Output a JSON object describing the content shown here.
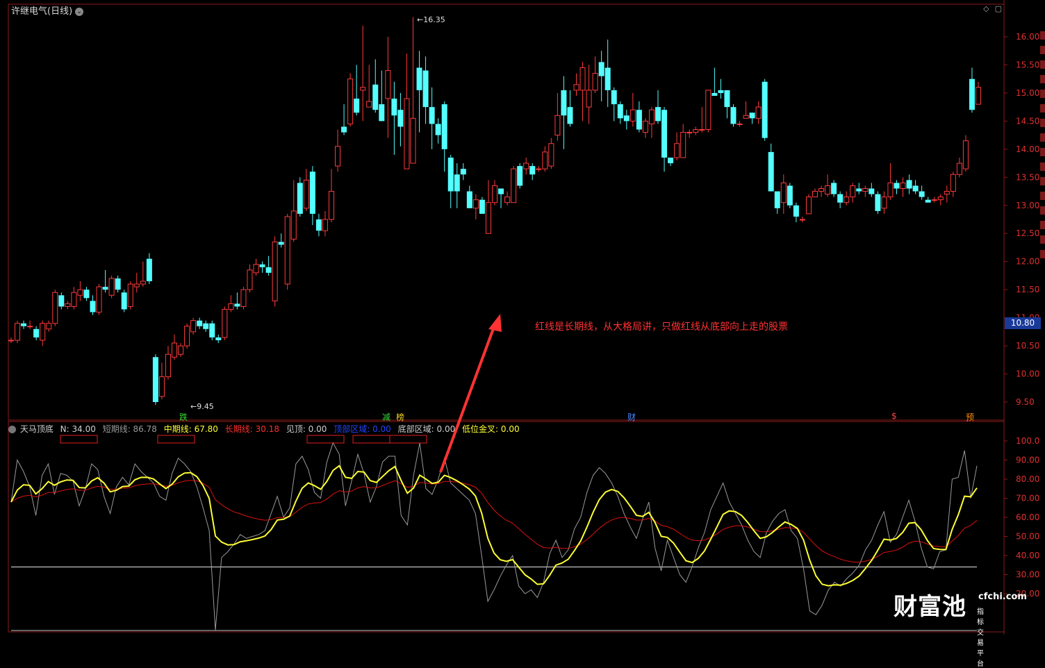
{
  "header": {
    "title": "许继电气(日线)",
    "dropdown_icon": "chevron-down-icon",
    "top_right_icons": [
      "diamond-icon",
      "window-icon"
    ]
  },
  "price_axis": {
    "ticks": [
      "16.00",
      "15.50",
      "15.00",
      "14.50",
      "14.00",
      "13.50",
      "13.00",
      "12.50",
      "12.00",
      "11.50",
      "11.00",
      "10.50",
      "10.00",
      "9.50"
    ],
    "current_price": "10.80"
  },
  "indicator_axis": {
    "ticks": [
      "100.0",
      "90.00",
      "80.00",
      "70.00",
      "60.00",
      "50.00",
      "40.00",
      "30.00",
      "20.00"
    ]
  },
  "price_labels": {
    "high": "16.35",
    "low": "9.45"
  },
  "event_markers": [
    {
      "text": "跌",
      "color": "#33dd33"
    },
    {
      "text": "减",
      "color": "#33dd33"
    },
    {
      "text": "榜",
      "color": "#f0d020"
    },
    {
      "text": "财",
      "color": "#4488ff"
    },
    {
      "text": "$",
      "color": "#ff4040"
    },
    {
      "text": "预",
      "color": "#ff8800"
    }
  ],
  "indicator": {
    "name": "天马顶底",
    "fields": [
      {
        "text": "N: 34.00",
        "color": "#d0d0d0"
      },
      {
        "text": "短期线: 86.78",
        "color": "#9a9a9a"
      },
      {
        "text": "中期线: 67.80",
        "color": "#ffff33"
      },
      {
        "text": "长期线: 30.18",
        "color": "#ff3030"
      },
      {
        "text": "见顶: 0.00",
        "color": "#d0d0d0"
      },
      {
        "text": "顶部区域: 0.00",
        "color": "#2244ff"
      },
      {
        "text": "底部区域: 0.00",
        "color": "#d0d0d0"
      },
      {
        "text": "低位金叉: 0.00",
        "color": "#ffff33"
      }
    ]
  },
  "annotation": "红线是长期线，从大格局讲，只做红线从底部向上走的股票",
  "watermark": {
    "brand": "财富池",
    "site": "cfchi.com",
    "tagline": "指标交易平台"
  },
  "colors": {
    "up": "#ff3b3b",
    "down": "#54ffff",
    "short_line": "#9a9a9a",
    "mid_line": "#ffff33",
    "long_line": "#dd1111",
    "frame": "#8b1a1a"
  },
  "chart_data": {
    "type": "candlestick",
    "candles": [
      [
        10.6,
        10.6,
        10.65,
        10.55
      ],
      [
        10.6,
        10.9,
        10.95,
        10.55
      ],
      [
        10.9,
        10.85,
        10.95,
        10.8
      ],
      [
        10.85,
        10.85,
        10.95,
        10.8
      ],
      [
        10.8,
        10.65,
        10.85,
        10.6
      ],
      [
        10.6,
        10.9,
        10.95,
        10.5
      ],
      [
        10.8,
        10.9,
        10.95,
        10.75
      ],
      [
        10.9,
        11.45,
        11.5,
        10.85
      ],
      [
        11.4,
        11.2,
        11.45,
        11.15
      ],
      [
        11.2,
        11.25,
        11.3,
        11.15
      ],
      [
        11.2,
        11.45,
        11.55,
        11.15
      ],
      [
        11.4,
        11.5,
        11.65,
        11.3
      ],
      [
        11.5,
        11.35,
        11.55,
        11.3
      ],
      [
        11.3,
        11.1,
        11.4,
        11.05
      ],
      [
        11.1,
        11.55,
        11.6,
        11.05
      ],
      [
        11.55,
        11.5,
        11.85,
        11.45
      ],
      [
        11.4,
        11.7,
        11.75,
        11.35
      ],
      [
        11.7,
        11.5,
        11.75,
        11.45
      ],
      [
        11.45,
        11.15,
        11.5,
        11.1
      ],
      [
        11.2,
        11.6,
        11.65,
        11.15
      ],
      [
        11.55,
        11.6,
        11.8,
        11.45
      ],
      [
        11.6,
        11.65,
        12.0,
        11.55
      ],
      [
        12.05,
        11.65,
        12.15,
        11.6
      ],
      [
        10.3,
        9.5,
        10.35,
        9.45
      ],
      [
        9.6,
        9.95,
        10.2,
        9.55
      ],
      [
        9.95,
        10.35,
        10.5,
        9.9
      ],
      [
        10.3,
        10.55,
        10.7,
        10.25
      ],
      [
        10.35,
        10.5,
        10.55,
        10.3
      ],
      [
        10.5,
        10.85,
        10.9,
        10.45
      ],
      [
        10.75,
        10.95,
        11.0,
        10.7
      ],
      [
        10.95,
        10.85,
        11.0,
        10.8
      ],
      [
        10.9,
        10.8,
        10.95,
        10.75
      ],
      [
        10.9,
        10.65,
        10.95,
        10.6
      ],
      [
        10.65,
        10.6,
        10.7,
        10.55
      ],
      [
        10.65,
        11.15,
        11.2,
        10.6
      ],
      [
        11.15,
        11.25,
        11.4,
        11.1
      ],
      [
        11.25,
        11.2,
        11.45,
        11.15
      ],
      [
        11.2,
        11.5,
        11.55,
        11.15
      ],
      [
        11.5,
        11.85,
        11.95,
        11.45
      ],
      [
        11.8,
        11.95,
        12.05,
        11.75
      ],
      [
        11.95,
        11.9,
        12.0,
        11.8
      ],
      [
        11.9,
        11.8,
        12.1,
        11.75
      ],
      [
        11.3,
        12.35,
        12.45,
        11.2
      ],
      [
        12.35,
        12.3,
        12.5,
        12.25
      ],
      [
        11.6,
        12.8,
        12.85,
        11.5
      ],
      [
        12.4,
        12.9,
        13.45,
        12.35
      ],
      [
        13.4,
        12.85,
        13.5,
        12.8
      ],
      [
        12.95,
        13.45,
        13.65,
        12.9
      ],
      [
        13.6,
        12.85,
        13.7,
        12.65
      ],
      [
        12.75,
        12.55,
        12.85,
        12.45
      ],
      [
        12.55,
        12.75,
        12.9,
        12.45
      ],
      [
        12.75,
        13.25,
        13.65,
        12.7
      ],
      [
        13.7,
        14.05,
        14.35,
        13.6
      ],
      [
        14.4,
        14.3,
        14.8,
        14.25
      ],
      [
        14.45,
        15.25,
        15.35,
        14.4
      ],
      [
        14.9,
        14.65,
        15.5,
        14.6
      ],
      [
        15.05,
        15.1,
        16.2,
        14.5
      ],
      [
        14.75,
        14.85,
        15.5,
        14.75
      ],
      [
        15.15,
        14.7,
        15.6,
        14.65
      ],
      [
        14.8,
        14.5,
        15.4,
        14.5
      ],
      [
        14.9,
        15.4,
        16.0,
        14.2
      ],
      [
        14.9,
        14.6,
        15.2,
        13.9
      ],
      [
        14.7,
        14.4,
        15.0,
        14.05
      ],
      [
        13.65,
        14.9,
        15.7,
        13.65
      ],
      [
        13.75,
        14.55,
        16.35,
        13.75
      ],
      [
        15.45,
        15.05,
        15.75,
        14.3
      ],
      [
        15.4,
        14.75,
        15.65,
        14.45
      ],
      [
        14.75,
        14.45,
        15.1,
        14.0
      ],
      [
        14.45,
        14.25,
        14.55,
        14.1
      ],
      [
        14.8,
        14.0,
        14.85,
        13.6
      ],
      [
        13.85,
        13.25,
        13.9,
        12.95
      ],
      [
        13.55,
        13.25,
        13.75,
        12.95
      ],
      [
        13.65,
        13.55,
        13.75,
        13.45
      ],
      [
        13.25,
        12.95,
        13.35,
        12.95
      ],
      [
        12.95,
        13.1,
        13.2,
        12.75
      ],
      [
        13.1,
        12.85,
        13.15,
        12.9
      ],
      [
        12.5,
        13.05,
        13.45,
        12.5
      ],
      [
        13.05,
        13.35,
        13.45,
        13.0
      ],
      [
        13.3,
        13.2,
        13.3,
        12.95
      ],
      [
        13.05,
        13.15,
        13.25,
        13.0
      ],
      [
        13.05,
        13.65,
        13.7,
        13.05
      ],
      [
        13.7,
        13.35,
        13.75,
        13.3
      ],
      [
        13.65,
        13.75,
        13.85,
        13.55
      ],
      [
        13.7,
        13.55,
        13.75,
        13.45
      ],
      [
        13.65,
        13.65,
        13.7,
        13.6
      ],
      [
        13.65,
        13.95,
        14.05,
        13.6
      ],
      [
        13.7,
        14.1,
        14.2,
        13.65
      ],
      [
        14.25,
        14.6,
        15.0,
        14.15
      ],
      [
        15.05,
        14.6,
        15.3,
        14.0
      ],
      [
        14.75,
        14.45,
        15.05,
        14.4
      ],
      [
        15.05,
        15.15,
        15.35,
        14.95
      ],
      [
        15.05,
        15.45,
        15.55,
        14.5
      ],
      [
        14.75,
        15.05,
        15.5,
        14.45
      ],
      [
        15.05,
        15.35,
        15.65,
        15.0
      ],
      [
        15.55,
        15.3,
        15.75,
        14.85
      ],
      [
        15.45,
        15.05,
        15.95,
        14.75
      ],
      [
        15.05,
        14.8,
        15.1,
        14.5
      ],
      [
        14.8,
        14.55,
        14.85,
        14.45
      ],
      [
        14.6,
        14.5,
        14.7,
        14.35
      ],
      [
        14.5,
        14.7,
        15.0,
        14.4
      ],
      [
        14.7,
        14.35,
        14.85,
        14.3
      ],
      [
        14.3,
        14.5,
        14.55,
        14.2
      ],
      [
        14.45,
        14.7,
        14.75,
        14.2
      ],
      [
        14.75,
        14.5,
        15.05,
        14.45
      ],
      [
        14.7,
        13.85,
        14.75,
        13.6
      ],
      [
        13.85,
        13.75,
        13.85,
        13.7
      ],
      [
        13.85,
        14.1,
        14.3,
        13.8
      ],
      [
        13.85,
        14.3,
        14.45,
        13.85
      ],
      [
        14.3,
        14.3,
        14.35,
        14.2
      ],
      [
        14.3,
        14.35,
        14.4,
        14.25
      ],
      [
        14.35,
        14.35,
        14.75,
        14.3
      ],
      [
        14.35,
        15.05,
        15.05,
        14.3
      ],
      [
        15.0,
        14.95,
        15.45,
        14.95
      ],
      [
        15.05,
        15.0,
        15.25,
        14.9
      ],
      [
        15.05,
        14.75,
        15.0,
        14.55
      ],
      [
        14.75,
        14.45,
        14.8,
        14.4
      ],
      [
        14.45,
        14.45,
        14.5,
        14.4
      ],
      [
        14.55,
        14.6,
        14.85,
        14.55
      ],
      [
        14.65,
        14.55,
        14.65,
        14.45
      ],
      [
        14.55,
        14.75,
        14.85,
        14.45
      ],
      [
        15.2,
        14.2,
        15.25,
        14.15
      ],
      [
        13.95,
        13.25,
        14.1,
        13.25
      ],
      [
        13.25,
        12.95,
        13.2,
        12.85
      ],
      [
        13.05,
        13.4,
        13.55,
        12.85
      ],
      [
        13.35,
        13.0,
        13.4,
        12.95
      ],
      [
        13.0,
        12.8,
        13.05,
        12.7
      ],
      [
        12.75,
        12.75,
        12.8,
        12.7
      ],
      [
        12.85,
        13.15,
        13.2,
        12.85
      ],
      [
        13.15,
        13.25,
        13.3,
        13.2
      ],
      [
        13.25,
        13.3,
        13.35,
        13.15
      ],
      [
        13.2,
        13.35,
        13.55,
        13.15
      ],
      [
        13.4,
        13.2,
        13.45,
        13.15
      ],
      [
        13.2,
        13.05,
        13.25,
        12.95
      ],
      [
        13.05,
        13.15,
        13.25,
        13.0
      ],
      [
        13.15,
        13.35,
        13.4,
        13.05
      ],
      [
        13.3,
        13.25,
        13.4,
        13.2
      ],
      [
        13.25,
        13.3,
        13.35,
        13.15
      ],
      [
        13.3,
        13.2,
        13.4,
        13.15
      ],
      [
        13.2,
        12.9,
        13.25,
        12.85
      ],
      [
        12.95,
        13.15,
        13.25,
        12.85
      ],
      [
        13.15,
        13.4,
        13.75,
        13.1
      ],
      [
        13.4,
        13.3,
        13.45,
        13.2
      ],
      [
        13.3,
        13.4,
        13.5,
        13.15
      ],
      [
        13.45,
        13.3,
        13.55,
        13.2
      ],
      [
        13.35,
        13.25,
        13.45,
        13.2
      ],
      [
        13.25,
        13.15,
        13.35,
        13.1
      ],
      [
        13.1,
        13.05,
        13.15,
        13.05
      ],
      [
        13.1,
        13.1,
        13.15,
        13.05
      ],
      [
        13.1,
        13.15,
        13.2,
        13.0
      ],
      [
        13.2,
        13.25,
        13.35,
        13.05
      ],
      [
        13.25,
        13.55,
        13.6,
        13.15
      ],
      [
        13.55,
        13.75,
        13.85,
        13.5
      ],
      [
        13.65,
        14.15,
        14.25,
        13.6
      ],
      [
        15.25,
        14.7,
        15.45,
        14.65
      ],
      [
        14.8,
        15.1,
        15.2,
        14.8
      ]
    ],
    "indicator_range": [
      0,
      100
    ],
    "horizontal_level": 34,
    "short_line": [
      68,
      90,
      84,
      76,
      61,
      82,
      88,
      72,
      83,
      82,
      79,
      66,
      75,
      88,
      85,
      71,
      62,
      76,
      81,
      77,
      88,
      84,
      81,
      78,
      71,
      69,
      83,
      91,
      88,
      84,
      76,
      65,
      53,
      1,
      39,
      42,
      46,
      51,
      49,
      50,
      51,
      53,
      62,
      71,
      60,
      65,
      88,
      92,
      85,
      73,
      70,
      89,
      99,
      93,
      66,
      79,
      93,
      83,
      68,
      76,
      89,
      92,
      92,
      61,
      56,
      82,
      99,
      75,
      72,
      80,
      91,
      78,
      75,
      72,
      69,
      62,
      40,
      16,
      22,
      29,
      35,
      40,
      24,
      20,
      22,
      18,
      26,
      41,
      48,
      39,
      43,
      54,
      60,
      73,
      82,
      86,
      83,
      78,
      71,
      62,
      55,
      49,
      59,
      68,
      44,
      32,
      48,
      39,
      30,
      26,
      34,
      44,
      52,
      64,
      71,
      78,
      68,
      62,
      56,
      48,
      42,
      39,
      52,
      58,
      62,
      64,
      53,
      49,
      33,
      11,
      9,
      14,
      22,
      26,
      24,
      28,
      31,
      35,
      43,
      48,
      56,
      63,
      47,
      51,
      60,
      69,
      58,
      44,
      34,
      33,
      42,
      43,
      80,
      81,
      95,
      70,
      87
    ]
  }
}
